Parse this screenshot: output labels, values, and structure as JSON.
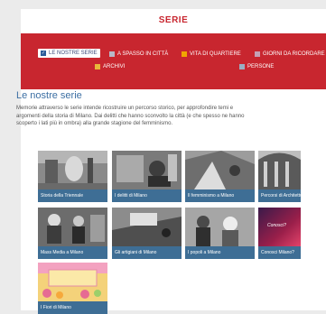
{
  "page_title": "SERIE",
  "filters": [
    {
      "label": "LE NOSTRE SERIE",
      "color": "#2b5c9a",
      "active": true
    },
    {
      "label": "A SPASSO IN CITTÀ",
      "color": "#b8b8c8",
      "active": false
    },
    {
      "label": "VITA DI QUARTIERE",
      "color": "#f1a500",
      "active": false
    },
    {
      "label": "GIORNI DA RICORDARE",
      "color": "#c5a0b5",
      "active": false
    },
    {
      "label": "ARCHIVI",
      "color": "#e8b83a",
      "active": false
    },
    {
      "label": "PERSONE",
      "color": "#9aaec2",
      "active": false
    }
  ],
  "section": {
    "heading": "Le nostre serie",
    "description_lines": [
      "Memorie attraverso le serie intende ricostruire un percorso storico, per approfondire temi e",
      "argomenti della storia di Milano. Dai delitti che hanno sconvolto la città (e che spesso ne hanno",
      "scoperto i lati più in ombra) alla grande stagione del femminismo."
    ]
  },
  "cards": [
    {
      "caption": "Storia della Triennale",
      "icon": "photo-triennale"
    },
    {
      "caption": "I delitti di Milano",
      "icon": "photo-delitti"
    },
    {
      "caption": "Il femminismo a Milano",
      "icon": "photo-femminismo"
    },
    {
      "caption": "Percorsi di Architettura",
      "icon": "photo-architettura"
    },
    {
      "caption": "Mass Media a Milano",
      "icon": "photo-mass-media"
    },
    {
      "caption": "Gli artigiani di Milano",
      "icon": "photo-artigiani"
    },
    {
      "caption": "I popoli a Milano",
      "icon": "photo-popoli"
    },
    {
      "caption": "Conosci Milano?",
      "icon": "photo-conosci",
      "overlay": "Conosci?"
    },
    {
      "caption": "I Fiori di Milano",
      "icon": "photo-fiori"
    }
  ],
  "colors": {
    "brand_red": "#c8262f",
    "heading_blue": "#3c6fa3",
    "caption_bg": "#3e6e95"
  }
}
